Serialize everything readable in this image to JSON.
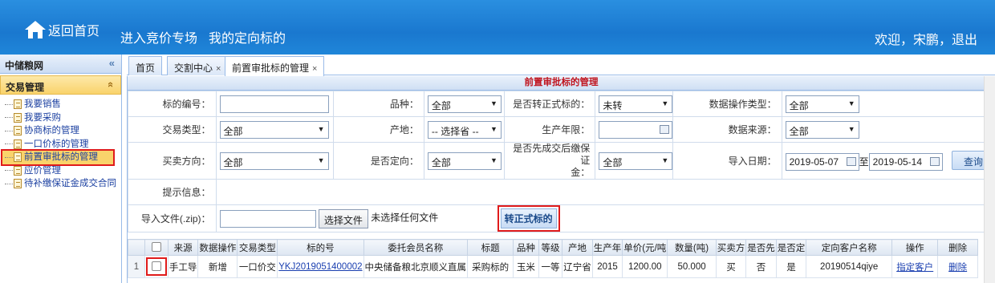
{
  "header": {
    "home": "返回首页",
    "nav1": "进入竞价专场",
    "nav2": "我的定向标的",
    "user_prefix": "欢迎，",
    "user_name": "宋鹏",
    "sep": "，",
    "logout": "退出"
  },
  "sidebar": {
    "title": "中储粮网",
    "title_toggle": "«",
    "section": "交易管理",
    "section_toggle": "«",
    "items": [
      {
        "label": "我要销售"
      },
      {
        "label": "我要采购"
      },
      {
        "label": "协商标的管理"
      },
      {
        "label": "一口价标的管理"
      },
      {
        "label": "前置审批标的管理"
      },
      {
        "label": "应价管理"
      },
      {
        "label": "待补缴保证金成交合同"
      }
    ]
  },
  "tabs": [
    {
      "label": "首页"
    },
    {
      "label": "交割中心"
    },
    {
      "label": "前置审批标的管理"
    }
  ],
  "tab_close": "×",
  "page_title": "前置审批标的管理",
  "form": {
    "bid_no_label": "标的编号：",
    "bid_no_value": "",
    "variety_label": "品种：",
    "variety_value": "全部",
    "is_formal_label": "是否转正式标的：",
    "is_formal_value": "未转",
    "data_op_label": "数据操作类型：",
    "data_op_value": "全部",
    "trade_type_label": "交易类型：",
    "trade_type_value": "全部",
    "origin_label": "产地：",
    "origin_value": "-- 选择省 --",
    "prod_year_label": "生产年限：",
    "prod_year_value": "",
    "data_source_label": "数据来源：",
    "data_source_value": "全部",
    "direction_label": "买卖方向：",
    "direction_value": "全部",
    "is_directed_label": "是否定向：",
    "is_directed_value": "全部",
    "deposit_label_1": "是否先成交后缴保证",
    "deposit_label_2": "金：",
    "deposit_value": "全部",
    "import_date_label": "导入日期：",
    "import_date_from": "2019-05-07",
    "to_label": "至",
    "import_date_to": "2019-05-14",
    "query_button": "查询",
    "info_label": "提示信息：",
    "import_file_label": "导入文件(.zip)：",
    "choose_file_button": "选择文件",
    "no_file_text": "未选择任何文件",
    "convert_button": "转正式标的"
  },
  "grid": {
    "headers": [
      "来源",
      "数据操作",
      "交易类型",
      "标的号",
      "委托会员名称",
      "标题",
      "品种",
      "等级",
      "产地",
      "生产年",
      "单价(元/吨",
      "数量(吨)",
      "买卖方",
      "是否先",
      "是否定",
      "定向客户名称",
      "操作",
      "删除"
    ],
    "rows": [
      {
        "index": "1",
        "source": "手工导",
        "data_op": "新增",
        "trade_type": "一口价交",
        "bid_no": "YKJ2019051400002",
        "member": "中央储备粮北京顺义直属",
        "title": "采购标的",
        "variety": "玉米",
        "grade": "一等",
        "origin": "辽宁省",
        "year": "2015",
        "price": "1200.00",
        "qty": "50.000",
        "direction": "买",
        "first": "否",
        "directed": "是",
        "client": "20190514qiye",
        "op": "指定客户",
        "del": "删除"
      }
    ]
  }
}
